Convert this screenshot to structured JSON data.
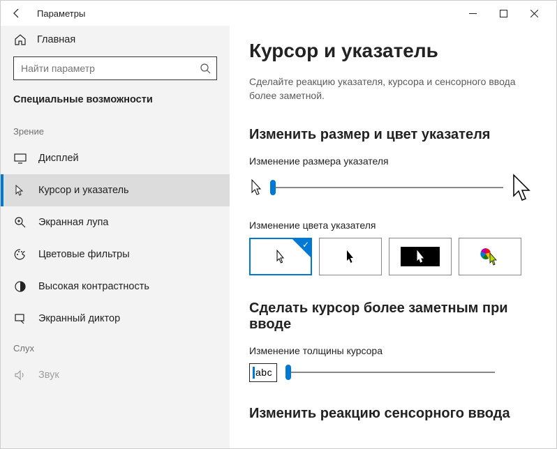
{
  "window": {
    "title": "Параметры"
  },
  "sidebar": {
    "home": "Главная",
    "search_placeholder": "Найти параметр",
    "section": "Специальные возможности",
    "groups": [
      {
        "label": "Зрение"
      },
      {
        "label": "Слух"
      }
    ],
    "items": [
      {
        "label": "Дисплей"
      },
      {
        "label": "Курсор и указатель"
      },
      {
        "label": "Экранная лупа"
      },
      {
        "label": "Цветовые фильтры"
      },
      {
        "label": "Высокая контрастность"
      },
      {
        "label": "Экранный диктор"
      }
    ],
    "cut_item": "Звук"
  },
  "main": {
    "h1": "Курсор и указатель",
    "desc": "Сделайте реакцию указателя, курсора и сенсорного ввода более заметной.",
    "section1_h": "Изменить размер и цвет указателя",
    "size_label": "Изменение размера указателя",
    "color_label": "Изменение цвета указателя",
    "section2_h": "Сделать курсор более заметным при вводе",
    "thickness_label": "Изменение толщины курсора",
    "abc": "abc",
    "section3_h": "Изменить реакцию сенсорного ввода"
  }
}
